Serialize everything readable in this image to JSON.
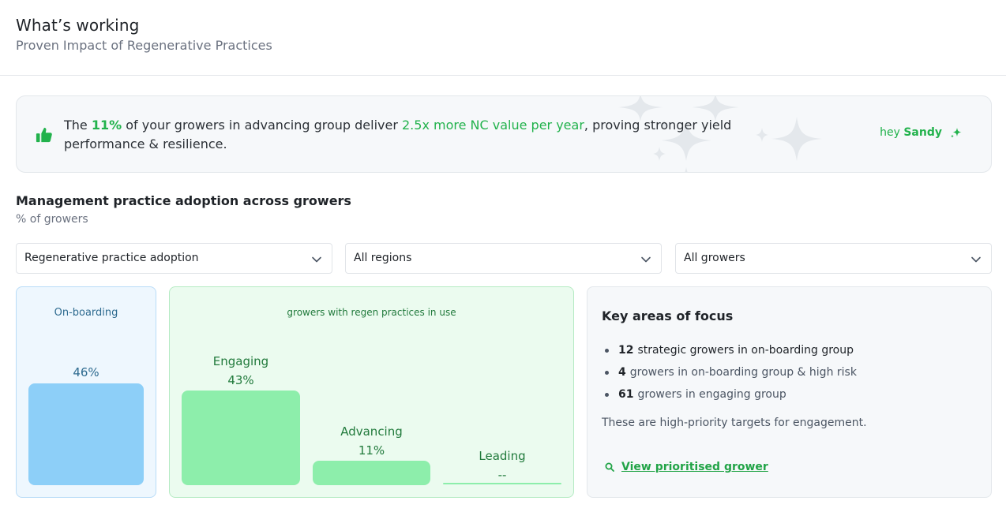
{
  "header": {
    "title": "What’s working",
    "subtitle": "Proven Impact of Regenerative Practices"
  },
  "insight": {
    "text_1": "The ",
    "highlight_pct": "11%",
    "text_2": " of your growers in advancing group deliver ",
    "highlight_value": "2.5x more NC value per year",
    "text_3": ", proving stronger yield performance & resilience.",
    "greeting_prefix": "hey",
    "greeting_name": "Sandy",
    "icon": "thumbs-up-icon"
  },
  "section": {
    "title": "Management practice adoption across growers",
    "subtitle": "% of growers"
  },
  "filters": [
    {
      "value": "Regenerative practice adoption"
    },
    {
      "value": "All regions"
    },
    {
      "value": "All growers"
    }
  ],
  "onboarding": {
    "label": "On-boarding",
    "value_label": "46%",
    "value": 46
  },
  "regen_group": {
    "caption": "growers with regen practices in use",
    "stages": [
      {
        "label": "Engaging",
        "value_label": "43%",
        "value": 43
      },
      {
        "label": "Advancing",
        "value_label": "11%",
        "value": 11
      },
      {
        "label": "Leading",
        "value_label": "--",
        "value": 0
      }
    ]
  },
  "focus": {
    "title": "Key areas of focus",
    "items": [
      {
        "count": "12",
        "text": "strategic growers in on-boarding group"
      },
      {
        "count": "4",
        "text": "growers in on-boarding group & high risk"
      },
      {
        "count": "61",
        "text": "growers in engaging group"
      }
    ],
    "note": "These are high-priority targets for engagement.",
    "link": "View prioritised grower"
  },
  "colors": {
    "accent_green": "#22b24c",
    "onboarding_bar": "#8dcff8",
    "regen_bar": "#8deeab",
    "onboarding_text": "#2d6a8f",
    "regen_text": "#217a3c"
  }
}
